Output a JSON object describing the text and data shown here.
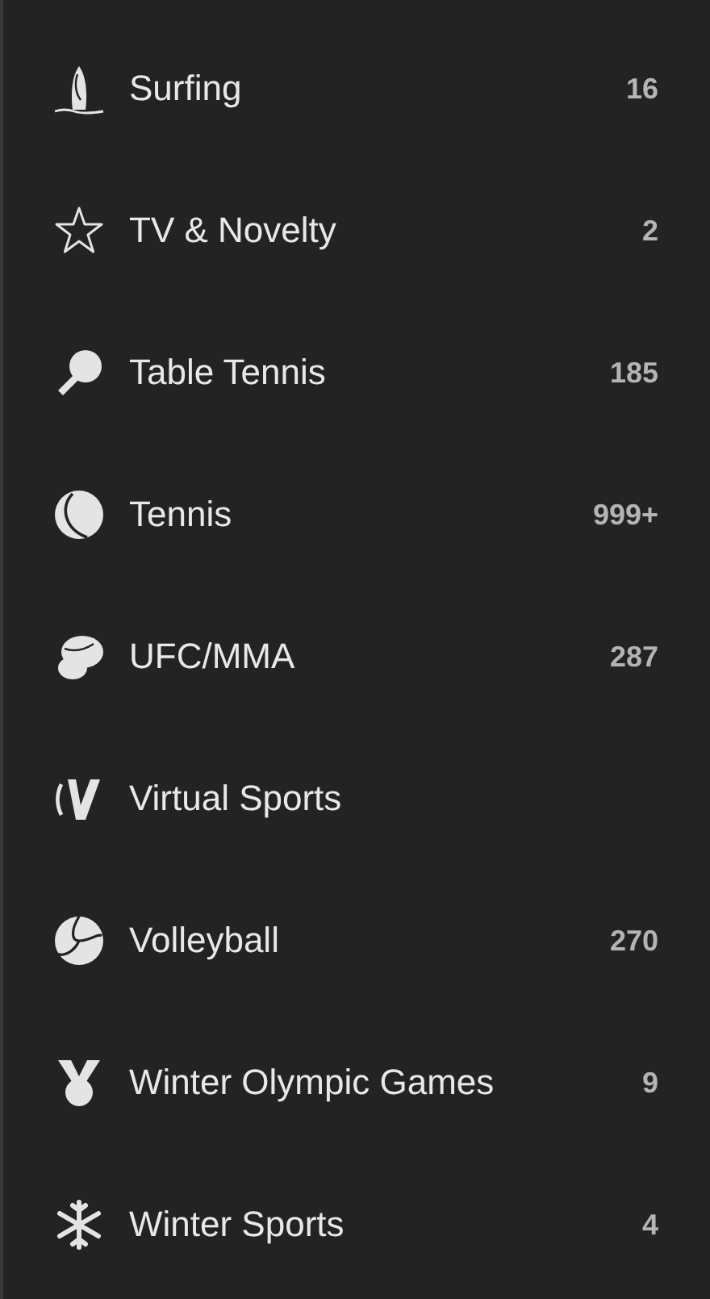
{
  "sports": [
    {
      "kind": "surfing",
      "label": "Surfing",
      "count": "16"
    },
    {
      "kind": "star",
      "label": "TV & Novelty",
      "count": "2"
    },
    {
      "kind": "table-tennis",
      "label": "Table Tennis",
      "count": "185"
    },
    {
      "kind": "tennis",
      "label": "Tennis",
      "count": "999+"
    },
    {
      "kind": "glove",
      "label": "UFC/MMA",
      "count": "287"
    },
    {
      "kind": "virtual",
      "label": "Virtual Sports"
    },
    {
      "kind": "volleyball",
      "label": "Volleyball",
      "count": "270"
    },
    {
      "kind": "medal",
      "label": "Winter Olympic Games",
      "count": "9"
    },
    {
      "kind": "snowflake",
      "label": "Winter Sports",
      "count": "4"
    }
  ]
}
